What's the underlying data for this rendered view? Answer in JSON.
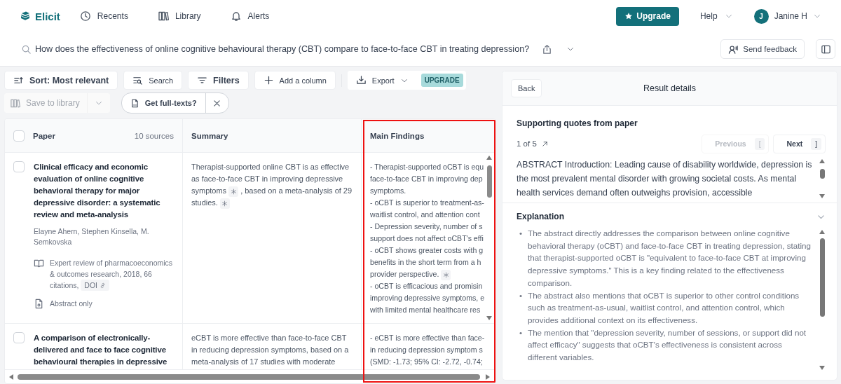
{
  "nav": {
    "logo": "Elicit",
    "links": [
      {
        "label": "Recents"
      },
      {
        "label": "Library"
      },
      {
        "label": "Alerts"
      }
    ],
    "upgrade": "Upgrade",
    "help": "Help",
    "user": {
      "initial": "J",
      "name": "Janine H"
    }
  },
  "query": {
    "text": "How does the effectiveness of online cognitive behavioural therapy (CBT) compare to face-to-face CBT in treating depression?",
    "feedback": "Send feedback"
  },
  "toolbar": {
    "buttons": [
      {
        "label": "Sort: Most relevant",
        "kind": "strong"
      },
      {
        "label": "Search",
        "kind": "plain"
      },
      {
        "label": "Filters",
        "kind": "strong"
      },
      {
        "label": "Add a column",
        "kind": "plain"
      }
    ],
    "export": "Export",
    "upgrade_badge": "UPGRADE",
    "save": {
      "label": "Save to library",
      "disabled": true
    },
    "fulltext": "Get full-texts?"
  },
  "table": {
    "all_selected": false,
    "columns": [
      {
        "label": "Paper",
        "count": "10 sources",
        "highlighted": false
      },
      {
        "label": "Summary",
        "highlighted": false
      },
      {
        "label": "Main Findings",
        "highlighted": true
      }
    ],
    "rows": [
      {
        "selected": false,
        "title": "Clinical efficacy and economic evaluation of online cognitive behavioral therapy for major depressive disorder: a systematic review and meta-analysis",
        "authors": "Elayne Ahern, Stephen Kinsella, M. Semkovska",
        "journal": "Expert review of pharmacoeconomics & outcomes research, 2018, 66 citations,",
        "doi": "DOI",
        "access": "Abstract only",
        "summary": [
          {
            "kind": "text",
            "text": "Therapist-supported online CBT is as effective as face-to-face CBT in improving depressive symptoms"
          },
          {
            "kind": "cite"
          },
          {
            "kind": "text",
            "text": ", based on a meta-analysis of 29 studies."
          },
          {
            "kind": "cite"
          }
        ],
        "findings": [
          {
            "text": "- Therapist-supported oCBT is equ",
            "cite": false
          },
          {
            "text": "face-to-face CBT in improving dep",
            "cite": false
          },
          {
            "text": "symptoms.",
            "cite": false
          },
          {
            "text": "- oCBT is superior to treatment-as-",
            "cite": false
          },
          {
            "text": "waitlist control, and attention cont",
            "cite": false
          },
          {
            "text": "- Depression severity, number of s",
            "cite": false
          },
          {
            "text": "support does not affect oCBT's effi",
            "cite": false
          },
          {
            "text": "- oCBT shows greater costs with g",
            "cite": false
          },
          {
            "text": "benefits in the short term from a h",
            "cite": false
          },
          {
            "text": "provider perspective.",
            "cite": true
          },
          {
            "text": "- oCBT is efficacious and promisin",
            "cite": false
          },
          {
            "text": "improving depressive symptoms, e",
            "cite": false
          },
          {
            "text": "with limited mental healthcare res",
            "cite": false
          }
        ]
      },
      {
        "selected": false,
        "title": "A comparison of electronically-delivered and face to face cognitive behavioural therapies in depressive",
        "summary": [
          {
            "kind": "text",
            "text": "eCBT is more effective than face-to-face CBT in reducing depression symptoms, based on a meta-analysis of 17 studies with moderate"
          }
        ],
        "findings": [
          {
            "text": "- eCBT is more effective than face-",
            "cite": false
          },
          {
            "text": "in reducing depression symptom s",
            "cite": false
          },
          {
            "text": "(SMD: -1.73; 95% CI: -2.72, -0.74;",
            "cite": false
          }
        ]
      }
    ]
  },
  "details": {
    "back": "Back",
    "title": "Result details",
    "quotes_title": "Supporting quotes from paper",
    "counter": "1 of 5",
    "previous": {
      "label": "Previous",
      "key": "[",
      "disabled": true
    },
    "next": {
      "label": "Next",
      "key": "]",
      "disabled": false
    },
    "quote": "ABSTRACT Introduction: Leading cause of disability worldwide, depression is the most prevalent mental disorder with growing societal costs. As mental health services demand often outweighs provision, accessible",
    "explanation_title": "Explanation",
    "expanded": true,
    "bullets": [
      {
        "marker": "•",
        "text": "The abstract directly addresses the comparison between online cognitive behavioral therapy (oCBT) and face-to-face CBT in treating depression, stating that therapist-supported oCBT is \"equivalent to face-to-face CBT at improving depressive symptoms.\" This is a key finding related to the effectiveness comparison."
      },
      {
        "marker": "•",
        "text": "The abstract also mentions that oCBT is superior to other control conditions such as treatment-as-usual, waitlist control, and attention control, which provides additional context on its effectiveness."
      },
      {
        "marker": "•",
        "text": "The mention that \"depression severity, number of sessions, or support did not affect efficacy\" suggests that oCBT's effectiveness is consistent across different variables."
      }
    ]
  }
}
